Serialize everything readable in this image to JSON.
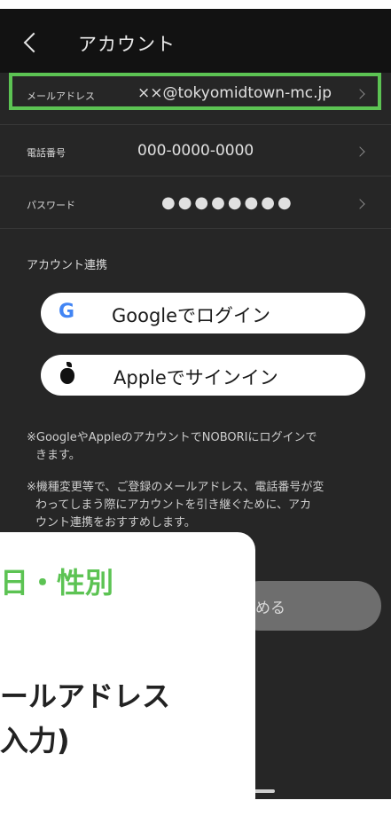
{
  "header": {
    "title": "アカウント"
  },
  "rows": [
    {
      "label": "メールアドレス",
      "value": "××@tokyomidtown-mc.jp"
    },
    {
      "label": "電話番号",
      "value": "000-0000-0000"
    },
    {
      "label": "パスワード",
      "value": "●●●●●●●●"
    }
  ],
  "section": {
    "label": "アカウント連携"
  },
  "buttons": {
    "google": "Googleでログイン",
    "apple": "Appleでサインイン",
    "cancel": "やめる"
  },
  "notes": {
    "note1_line1": "※GoogleやAppleのアカウントでNOBORIにログインで",
    "note1_line2": "きます。",
    "note2_line1": "※機種変更等で、ご登録のメールアドレス、電話番号が変",
    "note2_line2": "わってしまう際にアカウントを引き継ぐために、アカ",
    "note2_line3": "ウント連携をおすすめします。"
  },
  "overlay": {
    "line1": "日・性別",
    "line2": "ールアドレス",
    "line3": "入力)"
  },
  "colors": {
    "accent": "#5cc353",
    "background": "#262626",
    "header": "#121212"
  }
}
